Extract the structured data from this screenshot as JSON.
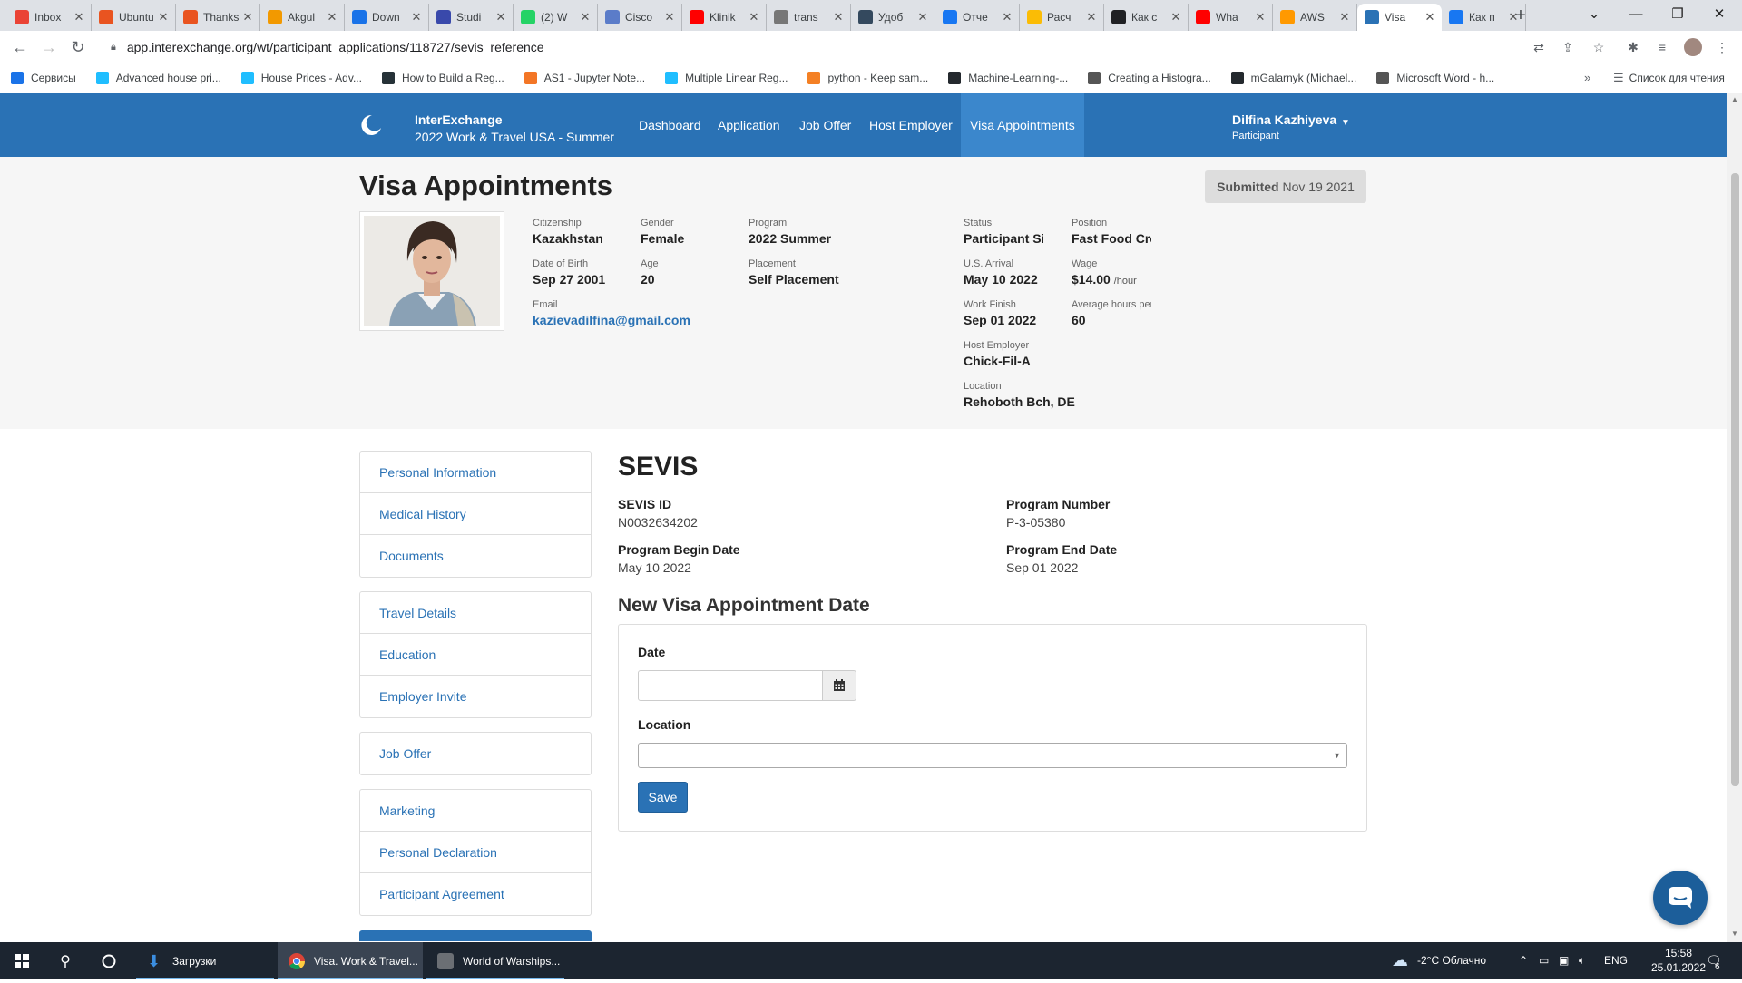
{
  "browser": {
    "tabs": [
      {
        "title": "Inbox",
        "icon": "gmail-icon",
        "color": "#ea4335"
      },
      {
        "title": "Ubuntu",
        "icon": "ubuntu-icon",
        "color": "#e95420"
      },
      {
        "title": "Thanks",
        "icon": "ubuntu-icon",
        "color": "#e95420"
      },
      {
        "title": "Akgul",
        "icon": "akgul-icon",
        "color": "#f29900"
      },
      {
        "title": "Down",
        "icon": "download-site-icon",
        "color": "#1a73e8"
      },
      {
        "title": "Studi",
        "icon": "studio-icon",
        "color": "#3949ab"
      },
      {
        "title": "(2) W",
        "icon": "whatsapp-icon",
        "color": "#25d366"
      },
      {
        "title": "Cisco",
        "icon": "cisco-icon",
        "color": "#5b7cc9"
      },
      {
        "title": "Klinik",
        "icon": "youtube-icon",
        "color": "#ff0000"
      },
      {
        "title": "trans",
        "icon": "globe-icon",
        "color": "#777777"
      },
      {
        "title": "Удоб",
        "icon": "site-icon",
        "color": "#34495e"
      },
      {
        "title": "Отче",
        "icon": "facebook-icon",
        "color": "#1877f2"
      },
      {
        "title": "Расч",
        "icon": "google-icon",
        "color": "#fbbc05"
      },
      {
        "title": "Как с",
        "icon": "question-icon",
        "color": "#202124"
      },
      {
        "title": "Wha",
        "icon": "youtube-icon",
        "color": "#ff0000"
      },
      {
        "title": "AWS",
        "icon": "aws-icon",
        "color": "#f90"
      },
      {
        "title": "Visa",
        "icon": "interexchange-icon",
        "color": "#2a72b5"
      },
      {
        "title": "Как п",
        "icon": "facebook-icon",
        "color": "#1877f2"
      }
    ],
    "url": "app.interexchange.org/wt/participant_applications/118727/sevis_reference",
    "bookmarks": [
      {
        "label": "Сервисы",
        "icon": "apps-grid-icon",
        "color": "#1a73e8"
      },
      {
        "label": "Advanced house pri...",
        "icon": "kaggle-icon",
        "color": "#20beff"
      },
      {
        "label": "House Prices - Adv...",
        "icon": "kaggle-icon",
        "color": "#20beff"
      },
      {
        "label": "How to Build a Reg...",
        "icon": "site-icon",
        "color": "#263238"
      },
      {
        "label": "AS1 - Jupyter Note...",
        "icon": "jupyter-icon",
        "color": "#f37626"
      },
      {
        "label": "Multiple Linear Reg...",
        "icon": "kaggle-icon",
        "color": "#20beff"
      },
      {
        "label": "python - Keep sam...",
        "icon": "stackoverflow-icon",
        "color": "#f48024"
      },
      {
        "label": "Machine-Learning-...",
        "icon": "github-icon",
        "color": "#24292e"
      },
      {
        "label": "Creating a Histogra...",
        "icon": "site-icon",
        "color": "#555555"
      },
      {
        "label": "mGalarnyk (Michael...",
        "icon": "github-icon",
        "color": "#24292e"
      },
      {
        "label": "Microsoft Word - h...",
        "icon": "globe-icon",
        "color": "#555555"
      }
    ],
    "reading_list": "Список для чтения"
  },
  "app": {
    "brand_name": "InterExchange",
    "program_title": "2022 Work & Travel USA - Summer",
    "nav": [
      "Dashboard",
      "Application",
      "Job Offer",
      "Host Employer",
      "Visa Appointments"
    ],
    "active_nav": "Visa Appointments",
    "user_name": "Dilfina Kazhiyeva",
    "user_role": "Participant",
    "accent": "#2a72b5"
  },
  "header": {
    "page_title": "Visa Appointments",
    "submitted_label": "Submitted",
    "submitted_date": "Nov 19 2021",
    "fields": {
      "citizenship": {
        "label": "Citizenship",
        "value": "Kazakhstan"
      },
      "gender": {
        "label": "Gender",
        "value": "Female"
      },
      "program": {
        "label": "Program",
        "value": "2022 Summer"
      },
      "dob": {
        "label": "Date of Birth",
        "value": "Sep 27 2001"
      },
      "age": {
        "label": "Age",
        "value": "20"
      },
      "placement": {
        "label": "Placement",
        "value": "Self Placement"
      },
      "email": {
        "label": "Email",
        "value": "kazievadilfina@gmail.com"
      },
      "status": {
        "label": "Status",
        "value": "Participant Si"
      },
      "position": {
        "label": "Position",
        "value": "Fast Food Cre"
      },
      "arrival": {
        "label": "U.S. Arrival",
        "value": "May 10 2022"
      },
      "wage": {
        "label": "Wage",
        "value": "$14.00",
        "unit": "/hour"
      },
      "work_finish": {
        "label": "Work Finish",
        "value": "Sep 01 2022"
      },
      "avg_hours": {
        "label": "Average hours per",
        "value": "60"
      },
      "host_employer": {
        "label": "Host Employer",
        "value": "Chick-Fil-A"
      },
      "location": {
        "label": "Location",
        "value": "Rehoboth Bch, DE"
      }
    }
  },
  "sidebar": {
    "groups": [
      [
        "Personal Information",
        "Medical History",
        "Documents"
      ],
      [
        "Travel Details",
        "Education",
        "Employer Invite"
      ],
      [
        "Job Offer"
      ],
      [
        "Marketing",
        "Personal Declaration",
        "Participant Agreement"
      ]
    ]
  },
  "sevis": {
    "heading": "SEVIS",
    "sevis_id_label": "SEVIS ID",
    "sevis_id": "N0032634202",
    "program_number_label": "Program Number",
    "program_number": "P-3-05380",
    "begin_label": "Program Begin Date",
    "begin_date": "May 10 2022",
    "end_label": "Program End Date",
    "end_date": "Sep 01 2022"
  },
  "form": {
    "heading": "New Visa Appointment Date",
    "date_label": "Date",
    "date_value": "",
    "location_label": "Location",
    "location_value": "",
    "save_label": "Save"
  },
  "taskbar": {
    "apps": [
      {
        "label": "Загрузки",
        "icon": "download-arrow-icon"
      },
      {
        "label": "Visa. Work & Travel...",
        "icon": "chrome-icon"
      },
      {
        "label": "World of Warships...",
        "icon": "warships-icon"
      }
    ],
    "weather": "-2°C Облачно",
    "language": "ENG",
    "time": "15:58",
    "date": "25.01.2022",
    "notifications": "6"
  }
}
